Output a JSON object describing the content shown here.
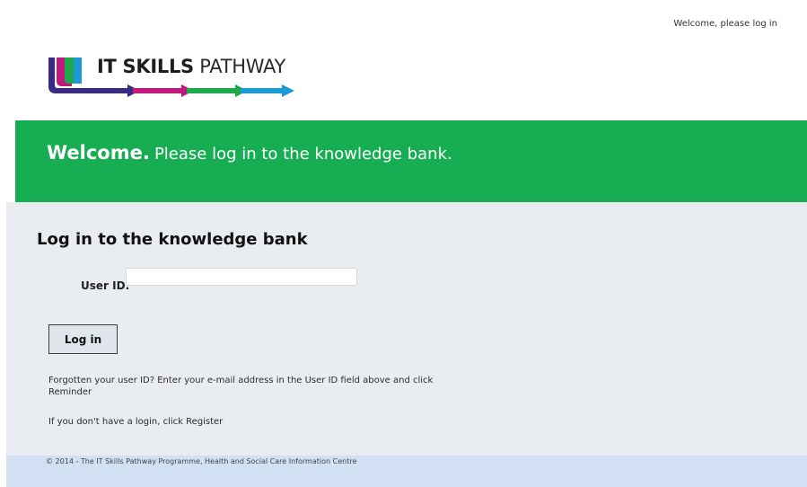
{
  "header": {
    "welcome_text": "Welcome, please log in"
  },
  "logo": {
    "bold_text": "IT SKILLS",
    "light_text": "PATHWAY",
    "colors": [
      "#3a2a82",
      "#c0197d",
      "#1fa84b",
      "#1b9ad6"
    ]
  },
  "banner": {
    "strong": "Welcome.",
    "rest": "Please log in to the knowledge bank.",
    "color": "#17ad52"
  },
  "login": {
    "heading": "Log in to the knowledge bank",
    "user_id_label": "User ID:",
    "user_id_value": "",
    "button_label": "Log in"
  },
  "help": {
    "forgotten_text": "Forgotten your user ID? Enter your e-mail address in the User ID field above and click",
    "reminder_link": "Reminder",
    "register_text": "If you don't have a login, click",
    "register_link": "Register"
  },
  "footer": {
    "text": "© 2014 - The IT Skills Pathway Programme, Health and Social Care Information Centre"
  }
}
